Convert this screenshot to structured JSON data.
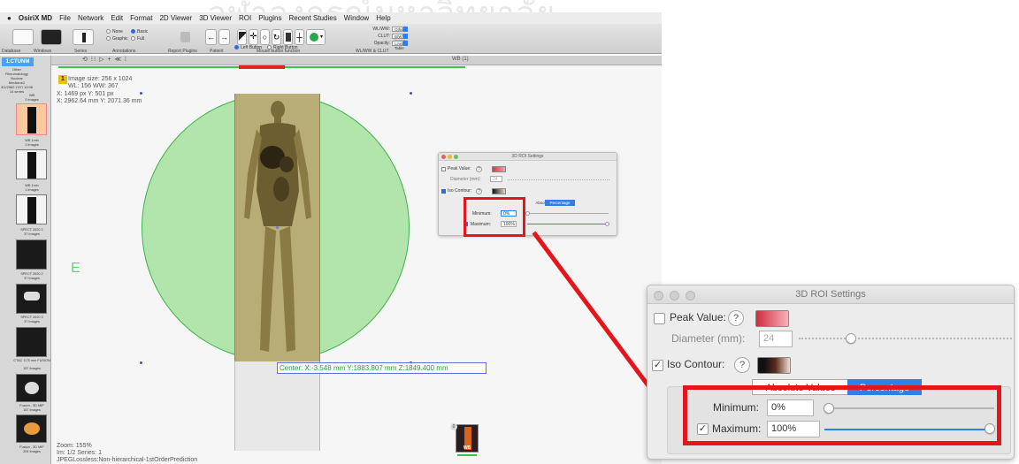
{
  "watermark": "จุฬาลงกรณ์มหาวิทยาลัย",
  "menubar": {
    "apple": "",
    "app_name": "OsiriX MD",
    "items": [
      "File",
      "Network",
      "Edit",
      "Format",
      "2D Viewer",
      "3D Viewer",
      "ROI",
      "Plugins",
      "Recent Studies",
      "Window",
      "Help"
    ]
  },
  "toolbar": {
    "radio_options": [
      {
        "label": "None",
        "selected": false
      },
      {
        "label": "Basic",
        "selected": true
      },
      {
        "label": "Graphic",
        "selected": false
      },
      {
        "label": "Full",
        "selected": false
      }
    ],
    "mouse_buttons": [
      {
        "label": "Left Button",
        "selected": true
      },
      {
        "label": "Right Button",
        "selected": false
      }
    ],
    "wlww": {
      "label": "WL/WW:",
      "value": "Other"
    },
    "clut": {
      "label": "CLUT:",
      "value": "B/W Inverse"
    },
    "opacity": {
      "label": "Opacity:",
      "value": "Linear Table"
    },
    "sections": [
      "Database",
      "Windows",
      "Series",
      "Annotations",
      "Report Plugins",
      "Patient",
      "Mouse button function",
      "WL/WW & CLUT"
    ]
  },
  "sidebar": {
    "badge": "1.CTUNM",
    "study_info": [
      "Other",
      "Rheumatology Nuclear",
      "Medicine2",
      "3/1/2562 เวลา 13:06",
      "14 series"
    ],
    "thumbs": [
      {
        "caption_top": "WB",
        "caption": "2 Images",
        "selected": true
      },
      {
        "caption_top": "WB 1min",
        "caption": "1 Images",
        "selected": false
      },
      {
        "caption_top": "WB 1min",
        "caption": "1 Images",
        "selected": false
      },
      {
        "caption_top": "SPECT 2020 1",
        "caption": "37 Images",
        "selected": false
      },
      {
        "caption_top": "SPECT 2020 2",
        "caption": "37 Images",
        "selected": false
      },
      {
        "caption_top": "SPECT 2020 3",
        "caption": "37 Images",
        "selected": false
      },
      {
        "caption_top": "CTAC 3.75 mm FUSION",
        "caption": "157 Images",
        "selected": false
      },
      {
        "caption_top": "Fusion - 3D MIP",
        "caption": "157 Images",
        "selected": false
      },
      {
        "caption_top": "Fusion - 3D MIP",
        "caption": "204 Images",
        "selected": false
      }
    ]
  },
  "viewer": {
    "header_title": "WB (1)",
    "image_number": "1",
    "overlay_top": [
      "Image size: 256 x 1024",
      "WL: 156 WW: 367",
      "X: 1469 px Y: 501 px",
      "X: 2962.64 mm Y: 2071.36 mm"
    ],
    "center_label": "Center: X:-3.548 mm Y:1883.807 mm Z:1849.400 mm",
    "edge_marker": "E",
    "overlay_bottom": [
      "Zoom: 155%",
      "Im: 1/2  Series: 1",
      "JPEGLossless:Non-hierarchical-1stOrderPrediction"
    ],
    "mini_thumb_badge": "0",
    "mini_thumb_label": "WB"
  },
  "roi_dialog": {
    "title": "3D ROI Settings",
    "peak_value": {
      "label": "Peak Value:",
      "checked": false,
      "color": "#e0404e"
    },
    "diameter": {
      "label": "Diameter (mm):",
      "value": "24",
      "slider_fraction": 0.24
    },
    "iso_contour": {
      "label": "Iso Contour:",
      "checked": true
    },
    "mode_tabs": [
      {
        "label": "Absolute Values",
        "selected": false
      },
      {
        "label": "Percentage",
        "selected": true
      }
    ],
    "minimum": {
      "label": "Minimum:",
      "value": "0%",
      "slider_fraction": 0.0
    },
    "maximum": {
      "label": "Maximum:",
      "value": "100%",
      "checked": true,
      "slider_fraction": 1.0
    },
    "help_glyph": "?",
    "check_glyph": "✓"
  },
  "colors": {
    "accent_blue": "#2f7fe6",
    "highlight_red": "#e3161b",
    "roi_green": "#3bc24b"
  }
}
